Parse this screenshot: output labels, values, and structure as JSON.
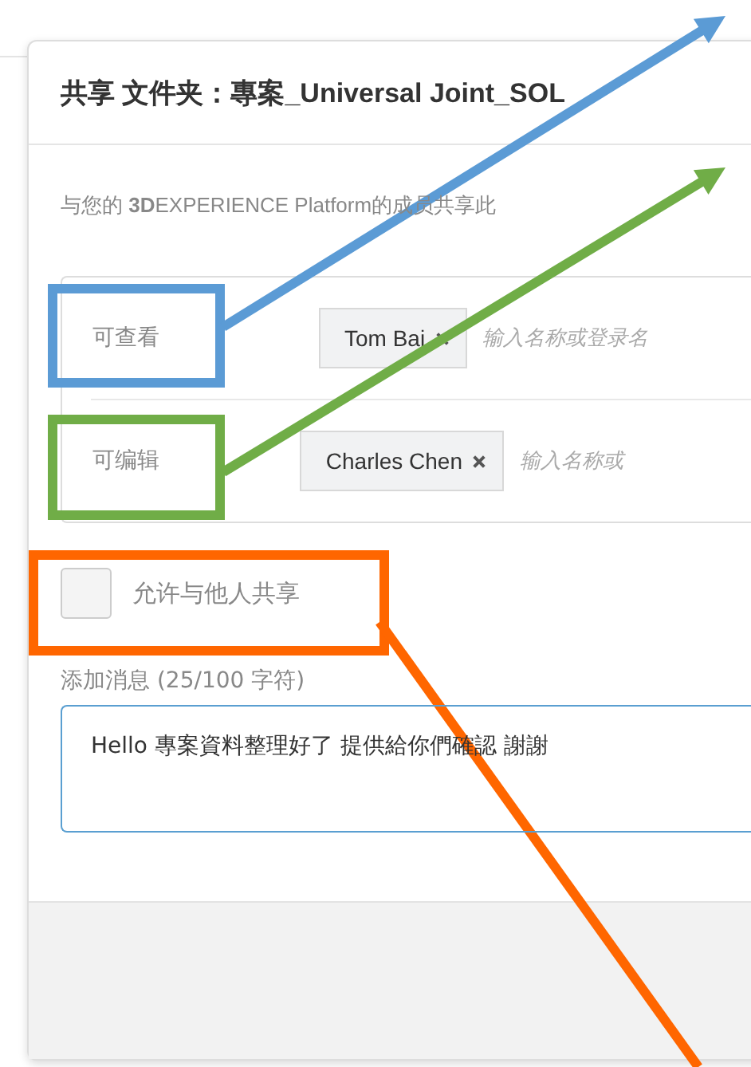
{
  "dialog": {
    "title": "共享 文件夹：專案_Universal Joint_SOL",
    "description": "与您的 **3D**EXPERIENCE Platform的成员共享此",
    "permissions": [
      {
        "label": "可查看",
        "members": [
          "Tom Bai"
        ],
        "placeholder": "输入名称或登录名"
      },
      {
        "label": "可编辑",
        "members": [
          "Charles Chen"
        ],
        "placeholder": "输入名称或"
      }
    ],
    "allow_share": {
      "label": "允许与他人共享",
      "checked": false
    },
    "message": {
      "label": "添加消息 (25/100 字符)",
      "value": "Hello 專案資料整理好了 提供給你們確認 謝謝"
    }
  },
  "annotations": [
    {
      "color": "#5b9bd5"
    },
    {
      "color": "#70ad47"
    },
    {
      "color": "#ff6600"
    }
  ]
}
